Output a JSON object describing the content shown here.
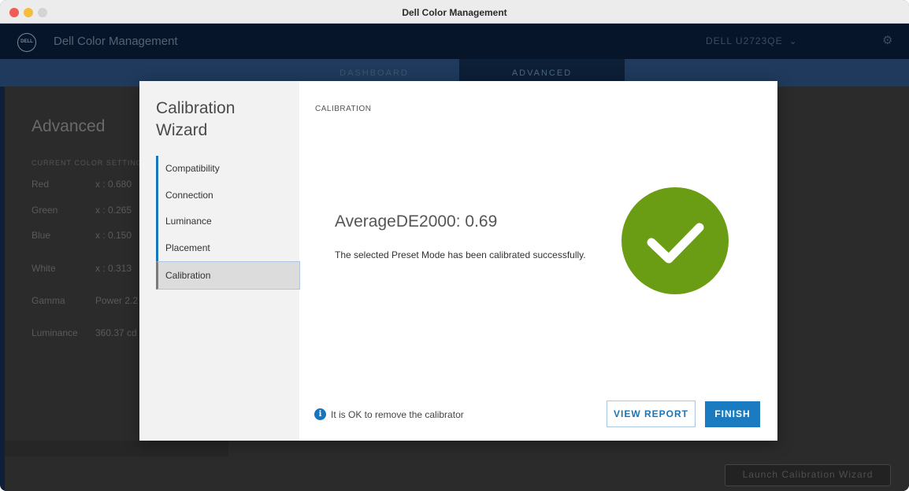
{
  "window": {
    "title": "Dell Color Management"
  },
  "app": {
    "logo_text": "DELL",
    "name": "Dell Color Management",
    "monitor": "DELL U2723QE",
    "monitor_chevron": "⌄",
    "settings_icon": "gear-icon"
  },
  "tabs": [
    {
      "label": "DASHBOARD"
    },
    {
      "label": "ADVANCED"
    }
  ],
  "advanced": {
    "title": "Advanced",
    "section_title": "CURRENT COLOR SETTINGS",
    "rows": [
      {
        "label": "Red",
        "value": "x : 0.680"
      },
      {
        "label": "Green",
        "value": "x : 0.265"
      },
      {
        "label": "Blue",
        "value": "x : 0.150"
      },
      {
        "label": "White",
        "value": "x : 0.313"
      },
      {
        "label": "Gamma",
        "value": "Power 2.2"
      },
      {
        "label": "Luminance",
        "value": "360.37 cd"
      }
    ],
    "launch_button": "Launch Calibration Wizard"
  },
  "wizard": {
    "title": "Calibration Wizard",
    "steps": [
      {
        "label": "Compatibility"
      },
      {
        "label": "Connection"
      },
      {
        "label": "Luminance"
      },
      {
        "label": "Placement"
      },
      {
        "label": "Calibration"
      }
    ],
    "active_step": "Calibration",
    "section_label": "CALIBRATION",
    "result_title": "AverageDE2000: 0.69",
    "result_message": "The selected Preset Mode has been calibrated successfully.",
    "info_text": "It is OK to remove the calibrator",
    "view_report_label": "VIEW REPORT",
    "finish_label": "FINISH"
  },
  "colors": {
    "accent": "#1775bb",
    "success": "#6a9d13"
  }
}
